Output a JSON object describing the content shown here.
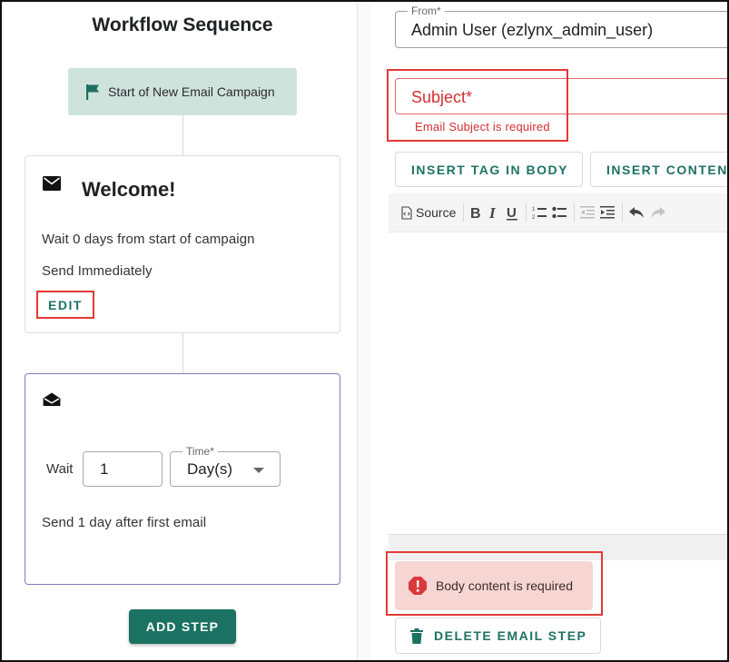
{
  "sidebar": {
    "title": "Workflow Sequence",
    "start_chip": {
      "label": "Start of New Email Campaign",
      "icon": "flag-icon"
    },
    "steps": [
      {
        "title": "Welcome!",
        "icon": "mail-icon",
        "wait_text": "Wait 0 days from start of campaign",
        "send_text": "Send Immediately",
        "edit_label": "EDIT"
      },
      {
        "icon": "mail-open-icon",
        "wait_label": "Wait",
        "wait_value": "1",
        "time_label": "Time*",
        "time_value": "Day(s)",
        "send_text": "Send 1 day after first email"
      }
    ],
    "add_step_label": "ADD STEP"
  },
  "editor": {
    "from_label": "From*",
    "from_value": "Admin User (ezlynx_admin_user)",
    "subject_label": "Subject*",
    "subject_error": "Email Subject is required",
    "insert_tag_label": "INSERT TAG IN BODY",
    "insert_content_label": "INSERT CONTENT",
    "toolbar": {
      "source_label": "Source"
    },
    "body_error": "Body content is required",
    "delete_label": "DELETE EMAIL STEP"
  },
  "colors": {
    "accent": "#1c7262",
    "error": "#d32f2f",
    "highlight": "#e53935",
    "chip_bg": "#cfe3dd",
    "alert_bg": "#f6d5d3"
  }
}
